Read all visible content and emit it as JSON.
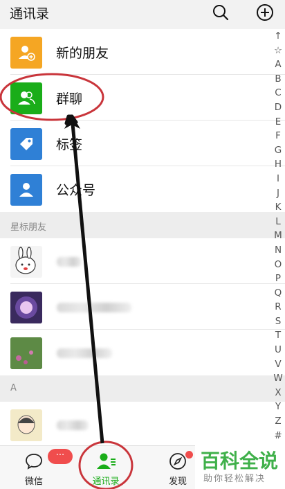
{
  "header": {
    "title": "通讯录",
    "search_icon": "search-icon",
    "add_icon": "plus-circle-icon"
  },
  "top_items": [
    {
      "label": "新的朋友",
      "color": "#f5a623",
      "icon": "add-friend-icon"
    },
    {
      "label": "群聊",
      "color": "#1aad19",
      "icon": "group-chat-icon"
    },
    {
      "label": "标签",
      "color": "#2f80d6",
      "icon": "tag-icon"
    },
    {
      "label": "公众号",
      "color": "#2f80d6",
      "icon": "official-account-icon"
    }
  ],
  "sections": [
    {
      "label": "星标朋友"
    },
    {
      "label": "A"
    }
  ],
  "index": [
    "↑",
    "☆",
    "A",
    "B",
    "C",
    "D",
    "E",
    "F",
    "G",
    "H",
    "I",
    "J",
    "K",
    "L",
    "M",
    "N",
    "O",
    "P",
    "Q",
    "R",
    "S",
    "T",
    "U",
    "V",
    "W",
    "X",
    "Y",
    "Z",
    "#"
  ],
  "tabs": [
    {
      "label": "微信",
      "badge": "···"
    },
    {
      "label": "通讯录",
      "active_color": "#1aad19"
    },
    {
      "label": "发现"
    }
  ],
  "watermark": {
    "title": "百科全说",
    "subtitle": "助你轻松解决"
  },
  "colors": {
    "accent": "#1aad19",
    "annotation": "#c9353b",
    "badge": "#f04d4d"
  }
}
